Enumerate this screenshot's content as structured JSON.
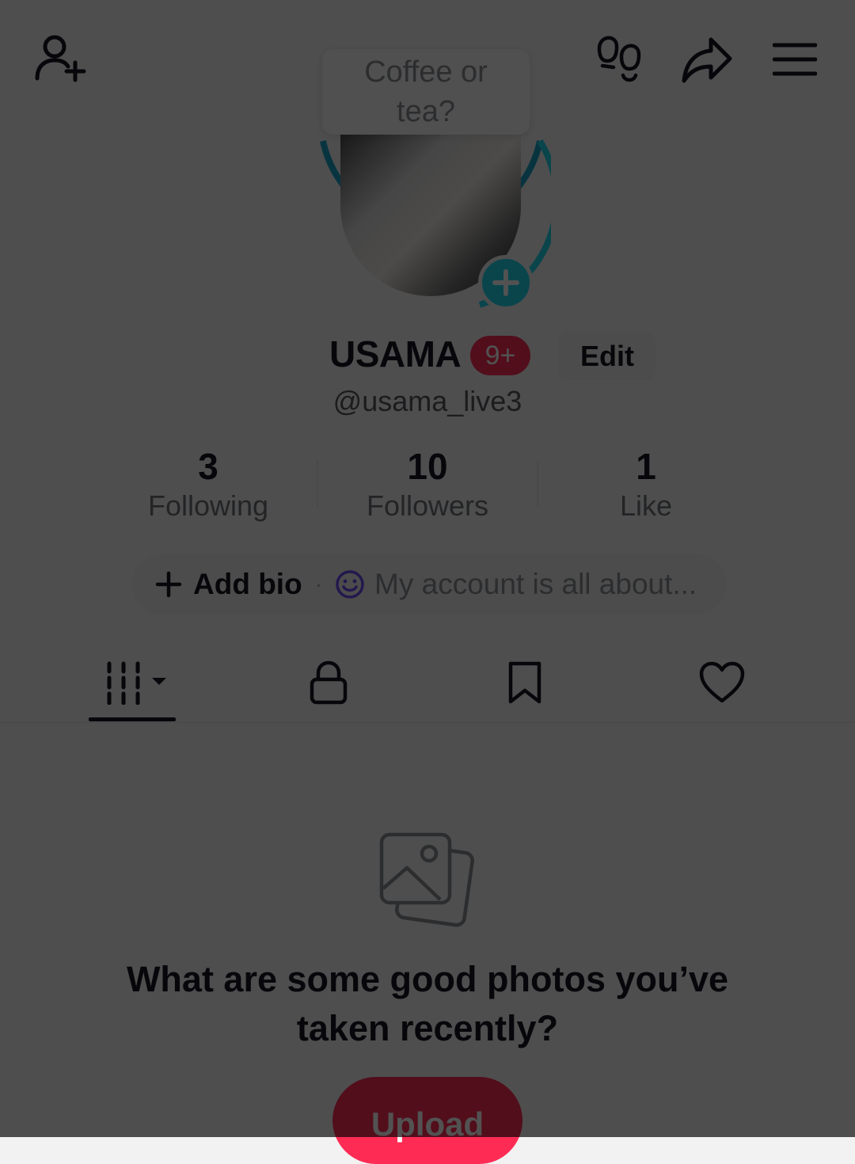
{
  "tooltip": {
    "text": "Coffee or tea?"
  },
  "profile": {
    "name": "USAMA",
    "badge_count": "9+",
    "edit_label": "Edit",
    "handle": "@usama_live3"
  },
  "stats": [
    {
      "value": "3",
      "label": "Following"
    },
    {
      "value": "10",
      "label": "Followers"
    },
    {
      "value": "1",
      "label": "Like"
    }
  ],
  "bio": {
    "add_label": "Add bio",
    "separator": "·",
    "placeholder": "My account is all about..."
  },
  "empty_state": {
    "title": "What are some good photos you’ve taken recently?",
    "upload_label": "Upload"
  },
  "colors": {
    "accent": "#fe2c55",
    "teal": "#20d5ec",
    "overlay": "#000000"
  },
  "icons": [
    "add-friend-icon",
    "footprints-icon",
    "share-icon",
    "menu-icon",
    "grid-icon",
    "lock-icon",
    "bookmark-icon",
    "heart-icon",
    "photos-icon",
    "smiley-icon",
    "plus-icon"
  ]
}
